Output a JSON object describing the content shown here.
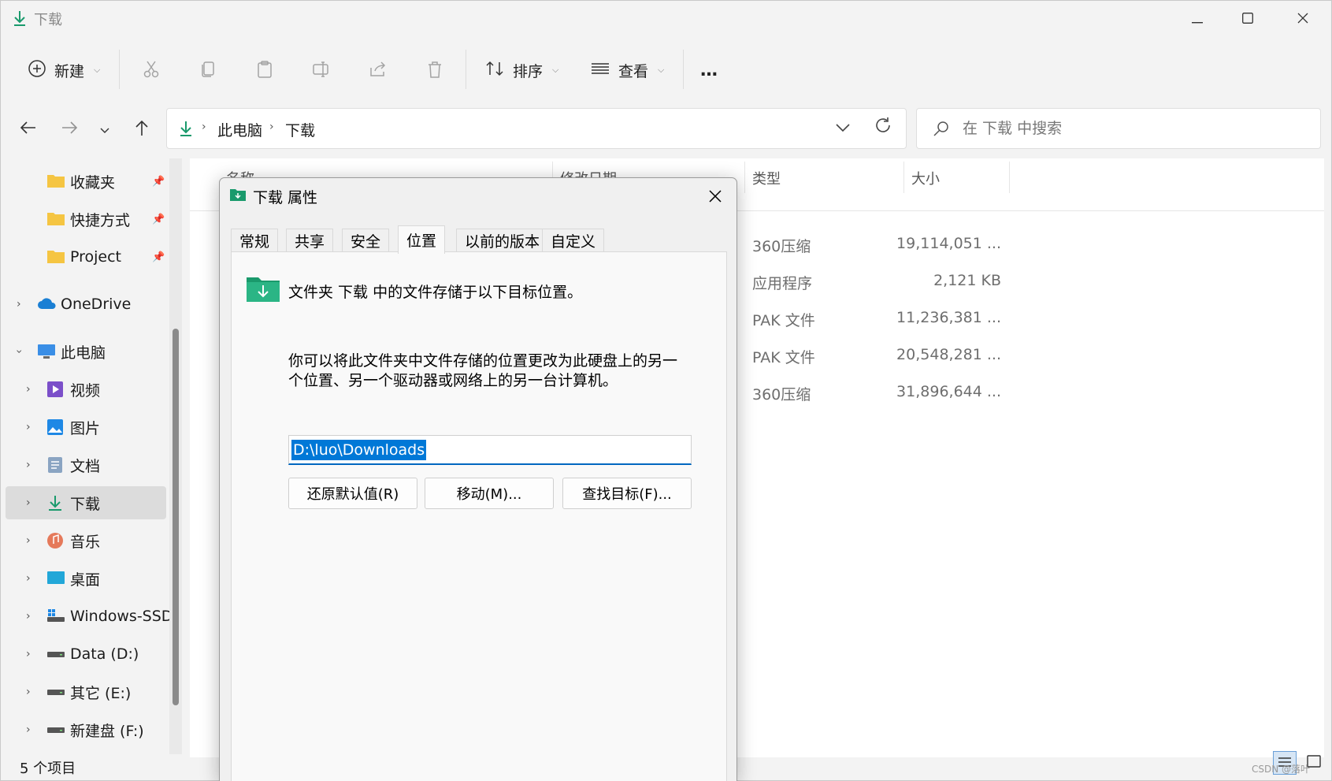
{
  "window": {
    "title": "下载",
    "controls": {
      "minimize": "minimize-icon",
      "maximize": "maximize-icon",
      "close": "close-icon"
    }
  },
  "toolbar": {
    "new_label": "新建",
    "sort_label": "排序",
    "view_label": "查看",
    "more": "…",
    "icons": [
      "cut-icon",
      "copy-icon",
      "paste-icon",
      "rename-icon",
      "share-icon",
      "delete-icon"
    ]
  },
  "address": {
    "crumbs": [
      "此电脑",
      "下载"
    ],
    "search_placeholder": "在 下载 中搜索"
  },
  "sidebar": {
    "items": [
      {
        "label": "收藏夹",
        "icon": "folder-icon",
        "pinned": true
      },
      {
        "label": "快捷方式",
        "icon": "folder-icon",
        "pinned": true
      },
      {
        "label": "Project",
        "icon": "folder-icon",
        "pinned": true
      },
      {
        "label": "OneDrive",
        "icon": "cloud-icon"
      },
      {
        "label": "此电脑",
        "icon": "computer-icon",
        "expanded": true
      },
      {
        "label": "视频",
        "icon": "video-icon"
      },
      {
        "label": "图片",
        "icon": "pictures-icon"
      },
      {
        "label": "文档",
        "icon": "documents-icon"
      },
      {
        "label": "下载",
        "icon": "download-icon",
        "selected": true
      },
      {
        "label": "音乐",
        "icon": "music-icon"
      },
      {
        "label": "桌面",
        "icon": "desktop-icon"
      },
      {
        "label": "Windows-SSD",
        "icon": "drive-icon"
      },
      {
        "label": "Data (D:)",
        "icon": "drive-icon"
      },
      {
        "label": "其它 (E:)",
        "icon": "drive-icon"
      },
      {
        "label": "新建盘 (F:)",
        "icon": "drive-icon"
      }
    ]
  },
  "filelist": {
    "columns": {
      "name": "名称",
      "modified": "修改日期",
      "type": "类型",
      "size": "大小"
    },
    "rows": [
      {
        "type": "360压缩",
        "size": "19,114,051 ..."
      },
      {
        "type": "应用程序",
        "size": "2,121 KB"
      },
      {
        "type": "PAK 文件",
        "size": "11,236,381 ..."
      },
      {
        "type": "PAK 文件",
        "size": "20,548,281 ..."
      },
      {
        "type": "360压缩",
        "size": "31,896,644 ..."
      }
    ]
  },
  "status": {
    "count_text": "5 个项目",
    "watermark": "CSDN @落叶"
  },
  "dialog": {
    "title": "下载 属性",
    "tabs": [
      "常规",
      "共享",
      "安全",
      "位置",
      "以前的版本",
      "自定义"
    ],
    "active_tab": "位置",
    "heading": "文件夹 下载 中的文件存储于以下目标位置。",
    "description": "你可以将此文件夹中文件存储的位置更改为此硬盘上的另一个位置、另一个驱动器或网络上的另一台计算机。",
    "path_value": "D:\\luo\\Downloads",
    "buttons": {
      "restore": "还原默认值(R)",
      "move": "移动(M)...",
      "find": "查找目标(F)..."
    }
  },
  "colors": {
    "accent": "#0078d7",
    "download_green": "#1a9a6c",
    "folder_yellow": "#f5c542"
  }
}
